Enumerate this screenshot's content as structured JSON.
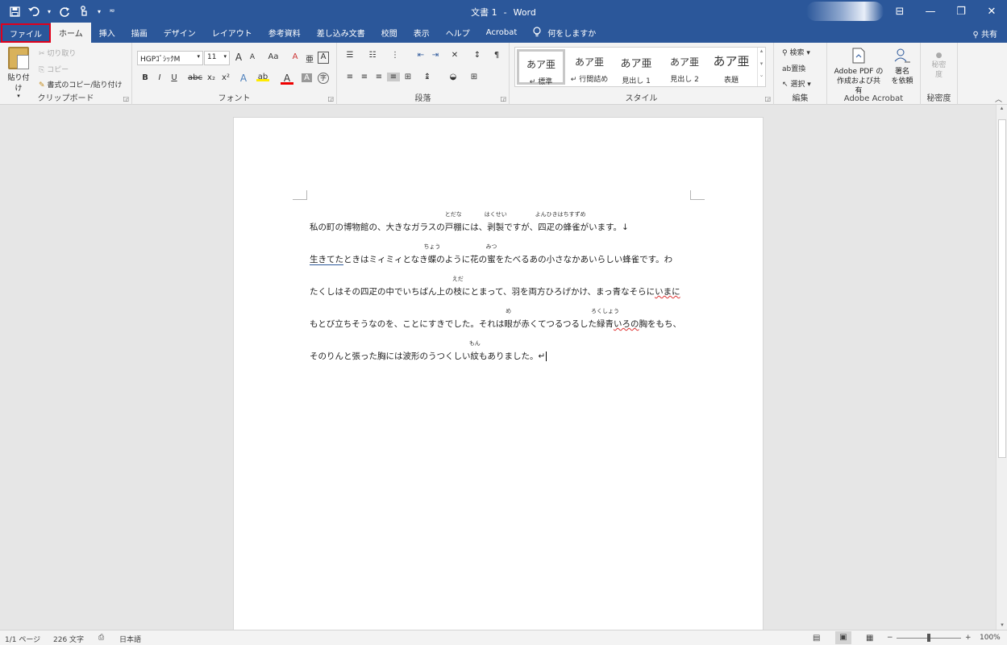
{
  "window": {
    "doc_name": "文書 1",
    "separator": "-",
    "app_name": "Word"
  },
  "qat": {
    "save_icon": "save-icon",
    "undo_icon": "undo-icon",
    "redo_icon": "redo-icon",
    "touch_icon": "touch-mode-icon",
    "customize_icon": "customize-qat-icon"
  },
  "controls": {
    "ribbon_display": "⊟",
    "minimize": "—",
    "restore": "❐",
    "close": "✕"
  },
  "tabs": [
    "ファイル",
    "ホーム",
    "挿入",
    "描画",
    "デザイン",
    "レイアウト",
    "参考資料",
    "差し込み文書",
    "校閲",
    "表示",
    "ヘルプ",
    "Acrobat"
  ],
  "tell_me": "何をしますか",
  "share": "共有",
  "clipboard": {
    "paste": "貼り付け",
    "cut": "切り取り",
    "copy": "コピー",
    "format_painter": "書式のコピー/貼り付け",
    "label": "クリップボード"
  },
  "font": {
    "name": "HGPｺﾞｼｯｸM",
    "size": "11",
    "grow": "A",
    "shrink": "A",
    "case": "Aa",
    "clear": "A",
    "bold": "B",
    "italic": "I",
    "underline": "U",
    "strike": "abc",
    "sub": "x₂",
    "sup": "x²",
    "effects": "A",
    "highlight": "ab",
    "color": "A",
    "shade": "A",
    "enclose": "字",
    "label": "フォント"
  },
  "paragraph": {
    "label": "段落"
  },
  "styles": {
    "items": [
      {
        "preview": "あア亜",
        "name": "↵ 標準"
      },
      {
        "preview": "あア亜",
        "name": "↵ 行間詰め"
      },
      {
        "preview": "あア亜",
        "name": "見出し 1"
      },
      {
        "preview": "あア亜",
        "name": "見出し 2"
      },
      {
        "preview": "あア亜",
        "name": "表題"
      }
    ],
    "label": "スタイル"
  },
  "editing": {
    "find": "検索",
    "replace": "置換",
    "select": "選択",
    "label": "編集"
  },
  "acrobat": {
    "create_pdf_1": "Adobe PDF の",
    "create_pdf_2": "作成および共有",
    "sign_1": "署名",
    "sign_2": "を依頼",
    "label": "Adobe Acrobat"
  },
  "sensitivity": {
    "btn_1": "秘密",
    "btn_2": "度",
    "label": "秘密度"
  },
  "document": {
    "l1": {
      "a": "私の町の博物館の、大きなガラスの",
      "b1": "戸棚",
      "r1": "とだな",
      "c": "には、",
      "b2": "剥製",
      "r2": "はくせい",
      "d": "ですが、",
      "b3": "四疋",
      "r3": "よんひき",
      "e": "の",
      "b4": "蜂雀",
      "r4": "はちすずめ",
      "f": "がいます。↓"
    },
    "l2": {
      "a": "生きてた",
      "b": "ときはミィミィとなき",
      "b1": "蝶",
      "r1": "ちょう",
      "c": "のように花の",
      "b2": "蜜",
      "r2": "みつ",
      "d": "をたべるあの小さなかあいらしい蜂雀です。わ"
    },
    "l3": {
      "a": "たくしはその四疋の中でいちばん上の",
      "b1": "枝",
      "r1": "えだ",
      "c": "にとまって、羽を両方ひろげかけ、まっ青なそらに",
      "d": "いまに"
    },
    "l4": {
      "a": "もとび立ちそうなのを、ことにすきでした。それは",
      "b1": "眼",
      "r1": "め",
      "c": "が赤くてつるつるした",
      "b2": "緑青",
      "r2": "ろくしょう",
      "d": "いろの",
      "e": "胸をもち、"
    },
    "l5": {
      "a": "そのりんと張った胸には波形のうつくしい",
      "b1": "紋",
      "r1": "もん",
      "c": "もありました。↵"
    }
  },
  "status": {
    "page": "1/1 ページ",
    "words": "226 文字",
    "lang": "日本語",
    "zoom": "100%",
    "zoom_minus": "−",
    "zoom_plus": "+"
  }
}
